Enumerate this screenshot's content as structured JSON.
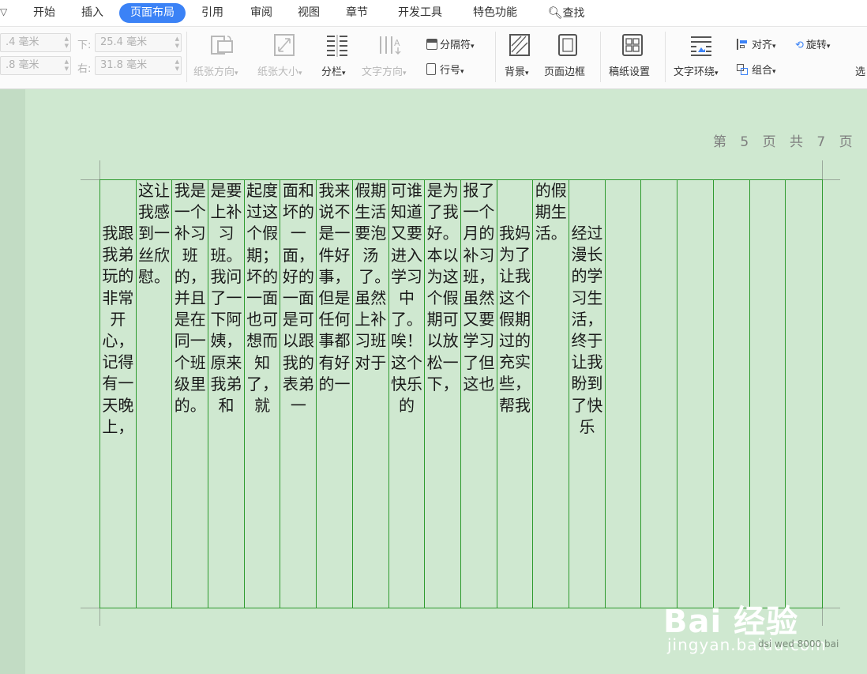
{
  "tabs": [
    {
      "label": "开始",
      "active": false
    },
    {
      "label": "插入",
      "active": false
    },
    {
      "label": "页面布局",
      "active": true
    },
    {
      "label": "引用",
      "active": false
    },
    {
      "label": "审阅",
      "active": false
    },
    {
      "label": "视图",
      "active": false
    },
    {
      "label": "章节",
      "active": false
    },
    {
      "label": "开发工具",
      "active": false
    },
    {
      "label": "特色功能",
      "active": false
    }
  ],
  "search_label": "查找",
  "margins": {
    "top_value": ".4 毫米",
    "left_value": ".8 毫米",
    "bottom_label": "下:",
    "bottom_value": "25.4 毫米",
    "right_label": "右:",
    "right_value": "31.8 毫米"
  },
  "ribbon": {
    "orientation": "纸张方向",
    "size": "纸张大小",
    "columns": "分栏",
    "text_direction": "文字方向",
    "separator": "分隔符",
    "line_number": "行号",
    "background": "背景",
    "page_border": "页面边框",
    "manuscript": "稿纸设置",
    "wrap": "文字环绕",
    "align": "对齐",
    "rotate": "旋转",
    "group": "组合",
    "select": "选"
  },
  "doc": {
    "header": "第 5 页 共 7 页",
    "columns": [
      "　我跟我弟玩的非常开心，记得有一天晚上，",
      "这让我感到一丝欣慰。",
      "我是一个补习班的，并且是在同一个班级里的。",
      "是要上补习班。我问了一下阿姨，原来我弟和",
      "起度过这个假期；坏的一面也可想而知了，就",
      "面和坏的一面，好的一面是可以跟我的表弟一",
      "我来说不是一件好事，但是任何事都有好的一",
      "假期生活要泡汤了。　　虽然上补习班对于",
      "可谁知道又要进入学习中了。唉！这个快乐的",
      "是为了我好。本以为这个假期可以放松一下，",
      "报了一个月的补习班，虽然又要学习了但这也",
      "　我妈为了让我这个假期过的充实些，帮我",
      "的假期生活。",
      "　经过漫长的学习生活，终于让我盼到了快乐",
      "",
      "",
      "",
      "",
      "",
      ""
    ]
  },
  "watermark": {
    "logo": "Bai 经验",
    "url": "jingyan.baidu.com",
    "small": "dsi wed 8000 bai"
  }
}
